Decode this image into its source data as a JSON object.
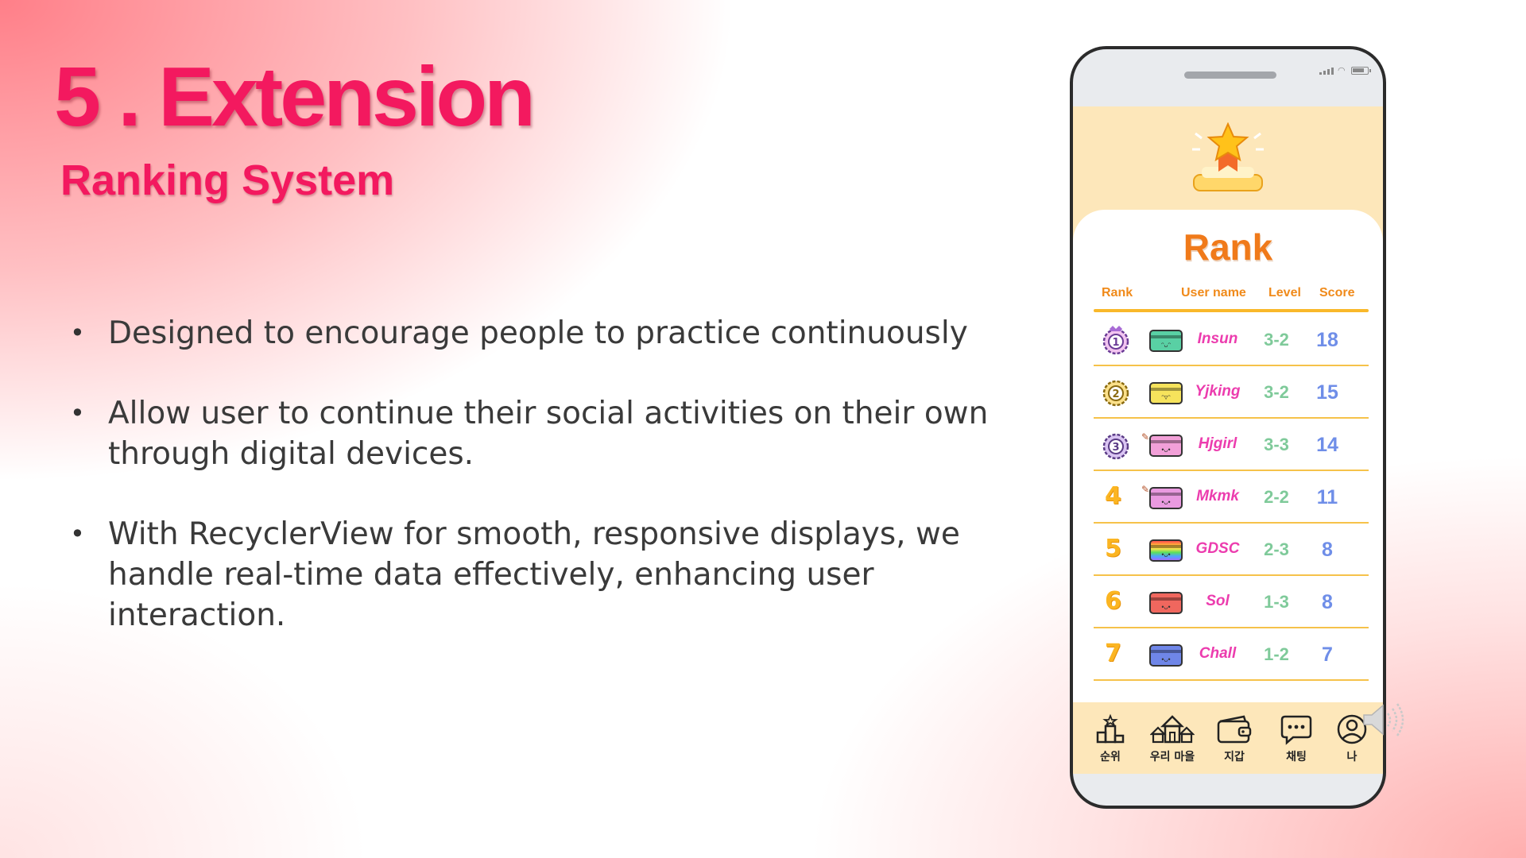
{
  "slide": {
    "title": "5 . Extension",
    "subtitle": "Ranking System",
    "bullets": [
      {
        "text": "Designed to encourage people to practice continuously"
      },
      {
        "text": "Allow user to continue their social activities on their own through digital devices."
      },
      {
        "text": "With RecyclerView for smooth, responsive displays, we handle real-time data effectively, enhancing user interaction."
      }
    ],
    "bullet_glyph": "•"
  },
  "phone": {
    "rank_title": "Rank",
    "columns": {
      "rank": "Rank",
      "user": "User name",
      "level": "Level",
      "score": "Score"
    },
    "rows": [
      {
        "rank": "1",
        "user": "Insun",
        "level": "3-2",
        "score": "18",
        "wallet_color": "#59d0a4",
        "face": "ᵔᴗᵔ"
      },
      {
        "rank": "2",
        "user": "Yjking",
        "level": "3-2",
        "score": "15",
        "wallet_color": "#f6e35c",
        "face": "ᵔ▿ᵔ"
      },
      {
        "rank": "3",
        "user": "Hjgirl",
        "level": "3-3",
        "score": "14",
        "wallet_color": "#f2a0d8",
        "face": "•ᴗ•"
      },
      {
        "rank": "4",
        "user": "Mkmk",
        "level": "2-2",
        "score": "11",
        "wallet_color": "#e99ae0",
        "face": "•ᴗ•"
      },
      {
        "rank": "5",
        "user": "GDSC",
        "level": "2-3",
        "score": "8",
        "wallet_color": "rainbow",
        "face": "•ᴗ•"
      },
      {
        "rank": "6",
        "user": "Sol",
        "level": "1-3",
        "score": "8",
        "wallet_color": "#f0675e",
        "face": "•ᴗ•"
      },
      {
        "rank": "7",
        "user": "Chall",
        "level": "1-2",
        "score": "7",
        "wallet_color": "#6f86e8",
        "face": "•ᴗ•"
      }
    ],
    "nav": [
      {
        "label": "순위",
        "icon": "podium-icon"
      },
      {
        "label": "우리 마을",
        "icon": "village-icon"
      },
      {
        "label": "지갑",
        "icon": "wallet-icon"
      },
      {
        "label": "채팅",
        "icon": "chat-icon"
      },
      {
        "label": "나",
        "icon": "profile-icon"
      }
    ]
  },
  "colors": {
    "title": "#f3195f",
    "rank_heading": "#f07a1a",
    "username": "#ec3cae",
    "level": "#7fca9a",
    "score": "#6f8ee8",
    "phone_bg": "#fde7ba"
  }
}
